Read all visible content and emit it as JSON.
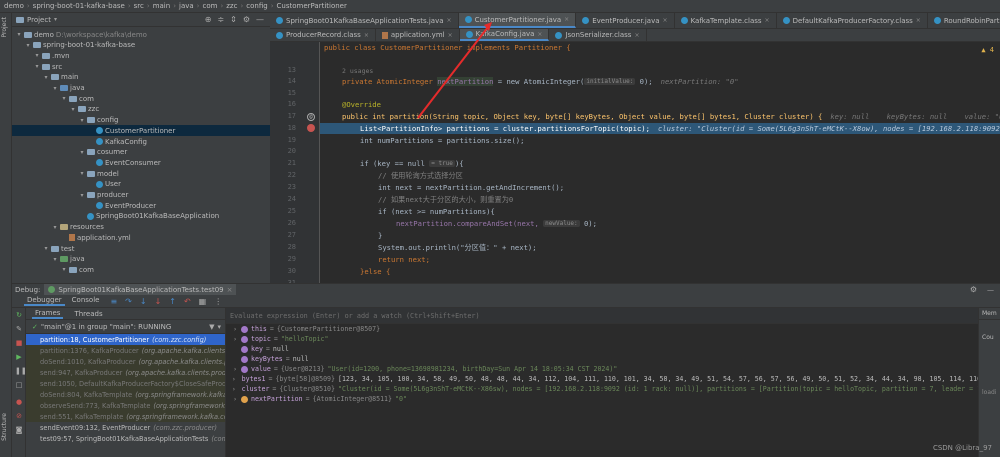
{
  "breadcrumb": [
    "demo",
    "spring-boot-01-kafka-base",
    "src",
    "main",
    "java",
    "com",
    "zzc",
    "config",
    "CustomerPartitioner"
  ],
  "project_panel": {
    "title": "Project",
    "items": [
      {
        "label": "demo",
        "path": "D:\\workspace\\kafka\\demo",
        "kind": "folder"
      },
      {
        "label": "spring-boot-01-kafka-base",
        "kind": "folder"
      },
      {
        "label": ".mvn",
        "kind": "folder"
      },
      {
        "label": "src",
        "kind": "folder"
      },
      {
        "label": "main",
        "kind": "folder"
      },
      {
        "label": "java",
        "kind": "src"
      },
      {
        "label": "com",
        "kind": "folder"
      },
      {
        "label": "zzc",
        "kind": "folder"
      },
      {
        "label": "config",
        "kind": "folder"
      },
      {
        "label": "CustomerPartitioner",
        "kind": "class"
      },
      {
        "label": "KafkaConfig",
        "kind": "class"
      },
      {
        "label": "cosumer",
        "kind": "folder"
      },
      {
        "label": "EventConsumer",
        "kind": "class"
      },
      {
        "label": "model",
        "kind": "folder"
      },
      {
        "label": "User",
        "kind": "class"
      },
      {
        "label": "producer",
        "kind": "folder"
      },
      {
        "label": "EventProducer",
        "kind": "class"
      },
      {
        "label": "SpringBoot01KafkaBaseApplication",
        "kind": "class"
      },
      {
        "label": "resources",
        "kind": "res"
      },
      {
        "label": "application.yml",
        "kind": "yaml"
      },
      {
        "label": "test",
        "kind": "folder"
      },
      {
        "label": "java",
        "kind": "test"
      },
      {
        "label": "com",
        "kind": "folder"
      }
    ]
  },
  "tabs_row1": [
    "SpringBoot01KafkaBaseApplicationTests.java",
    "CustomerPartitioner.java",
    "EventProducer.java",
    "KafkaTemplate.class",
    "DefaultKafkaProducerFactory.class",
    "RoundRobinPartitioner.class"
  ],
  "tabs_row2": [
    "ProducerRecord.class",
    "application.yml",
    "KafkaConfig.java",
    "JsonSerializer.class"
  ],
  "editor": {
    "line_numbers": [
      "",
      "",
      "13",
      "14",
      "15",
      "16",
      "17",
      "18",
      "19",
      "20",
      "21",
      "22",
      "23",
      "24",
      "25",
      "26",
      "27",
      "28",
      "29",
      "30",
      "31",
      "32"
    ],
    "warnings": "▲ 4",
    "class_decl": "public class CustomerPartitioner implements Partitioner {",
    "usages": "2 usages",
    "field_decl_a": "private AtomicInteger ",
    "field_name": "nextPartition",
    "field_decl_b": " = new AtomicInteger(",
    "field_inlay": "initialValue:",
    "field_decl_c": " 0);",
    "field_hint": "nextPartition: \"0\"",
    "override": "@Override",
    "method_sig": "public int partition(String topic, Object key, byte[] keyBytes, Object value, byte[] bytes1, Cluster cluster) {",
    "method_hint": "key: null    keyBytes: null    value: \"User",
    "partitions_line": "List<PartitionInfo> partitions = cluster.partitionsForTopic(topic);",
    "partitions_hint": "cluster: \"Cluster(id = Some(5L6g3nShT-eMCtK--X8ow), nodes = [192.168.2.118:9092",
    "num_line": "int numPartitions = partitions.size();",
    "if_line_a": "if (key == null ",
    "if_inlay": "= true",
    "if_line_b": "){",
    "comment1": "// 使用轮询方式选择分区",
    "next_line": "int next = nextPartition.getAndIncrement();",
    "comment2": "// 如果next大于分区的大小，则重置为0",
    "if2_line": "if (next >= numPartitions){",
    "cas_line_a": "nextPartition.compareAndSet(next, ",
    "cas_inlay": "newValue:",
    "cas_line_b": " 0);",
    "close1": "}",
    "println_line": "System.out.println(\"分区值：\" + next);",
    "return_line": "return next;",
    "else_line": "}else {"
  },
  "debug": {
    "label": "Debug:",
    "config": "SpringBoot01KafkaBaseApplicationTests.test09",
    "tabs": [
      "Debugger",
      "Console"
    ],
    "sub_tabs": [
      "Frames",
      "Threads"
    ],
    "thread": "\"main\"@1 in group \"main\": RUNNING",
    "frames": [
      {
        "method": "partition:18, CustomerPartitioner",
        "pkg": "(com.zzc.config)",
        "state": "sel"
      },
      {
        "method": "partition:1376, KafkaProducer",
        "pkg": "(org.apache.kafka.clients.prod",
        "state": "lib"
      },
      {
        "method": "doSend:1010, KafkaProducer",
        "pkg": "(org.apache.kafka.clients.prod",
        "state": "lib"
      },
      {
        "method": "send:947, KafkaProducer",
        "pkg": "(org.apache.kafka.clients.produ",
        "state": "lib"
      },
      {
        "method": "send:1050, DefaultKafkaProducerFactory$CloseSafeProduc",
        "pkg": "",
        "state": "lib"
      },
      {
        "method": "doSend:804, KafkaTemplate",
        "pkg": "(org.springframework.kafka.co",
        "state": "lib"
      },
      {
        "method": "observeSend:773, KafkaTemplate",
        "pkg": "(org.springframework.kafka",
        "state": "lib"
      },
      {
        "method": "send:551, KafkaTemplate",
        "pkg": "(org.springframework.kafka.core",
        "state": "lib"
      },
      {
        "method": "sendEvent09:132, EventProducer",
        "pkg": "(com.zzc.producer)",
        "state": "normal"
      },
      {
        "method": "test09:57, SpringBoot01KafkaBaseApplicationTests",
        "pkg": "(com.zz",
        "state": "normal"
      }
    ],
    "eval_placeholder": "Evaluate expression (Enter) or add a watch (Ctrl+Shift+Enter)",
    "variables": [
      {
        "name": "this",
        "obj": "{CustomerPartitioner@8507}",
        "value": "",
        "kind": "p",
        "expand": true
      },
      {
        "name": "topic",
        "obj": "",
        "value": "\"helloTopic\"",
        "kind": "p",
        "expand": true
      },
      {
        "name": "key",
        "obj": "",
        "value": "null",
        "kind": "p",
        "expand": false
      },
      {
        "name": "keyBytes",
        "obj": "",
        "value": "null",
        "kind": "p",
        "expand": false
      },
      {
        "name": "value",
        "obj": "{User@8213}",
        "value": "\"User(id=1200, phone=13698981234, birthDay=Sun Apr 14 18:05:34 CST 2024)\"",
        "kind": "p",
        "expand": true
      },
      {
        "name": "bytes1",
        "obj": "{byte[58]@8509}",
        "value": "[123, 34, 105, 100, 34, 58, 49, 50, 48, 48, 44, 34, 112, 104, 111, 110, 101, 34, 58, 34, 49, 51, 54, 57, 56, 57, 56, 49, 50, 51, 52, 34, 44, 34, 98, 105, 114, 116, 104, 68, 97, 121, 34, 58, 49, 55, 49, 51, 48, 56, 57",
        "kind": "p",
        "expand": true,
        "view": "... View"
      },
      {
        "name": "cluster",
        "obj": "{Cluster@8510}",
        "value": "\"Cluster(id = Some(5L6g3nShT-eMCtK--X86sw), nodes = [192.168.2.118:9092 (id: 1 rack: null)], partitions = [Partition(topic = helloTopic, partition = 7, leader = 1, replicas = [1], isr = [1], offlineReplicas =",
        "kind": "p",
        "expand": true,
        "view": "... View"
      },
      {
        "name": "nextPartition",
        "obj": "{AtomicInteger@8511}",
        "value": "\"0\"",
        "kind": "f",
        "expand": true
      }
    ]
  },
  "right_panel": {
    "title": "Mem",
    "item": "Cou",
    "sub": "loadi"
  },
  "left_stripe": {
    "project": "Project",
    "structure": "Structure"
  },
  "watermark": "CSDN @Libra_97"
}
